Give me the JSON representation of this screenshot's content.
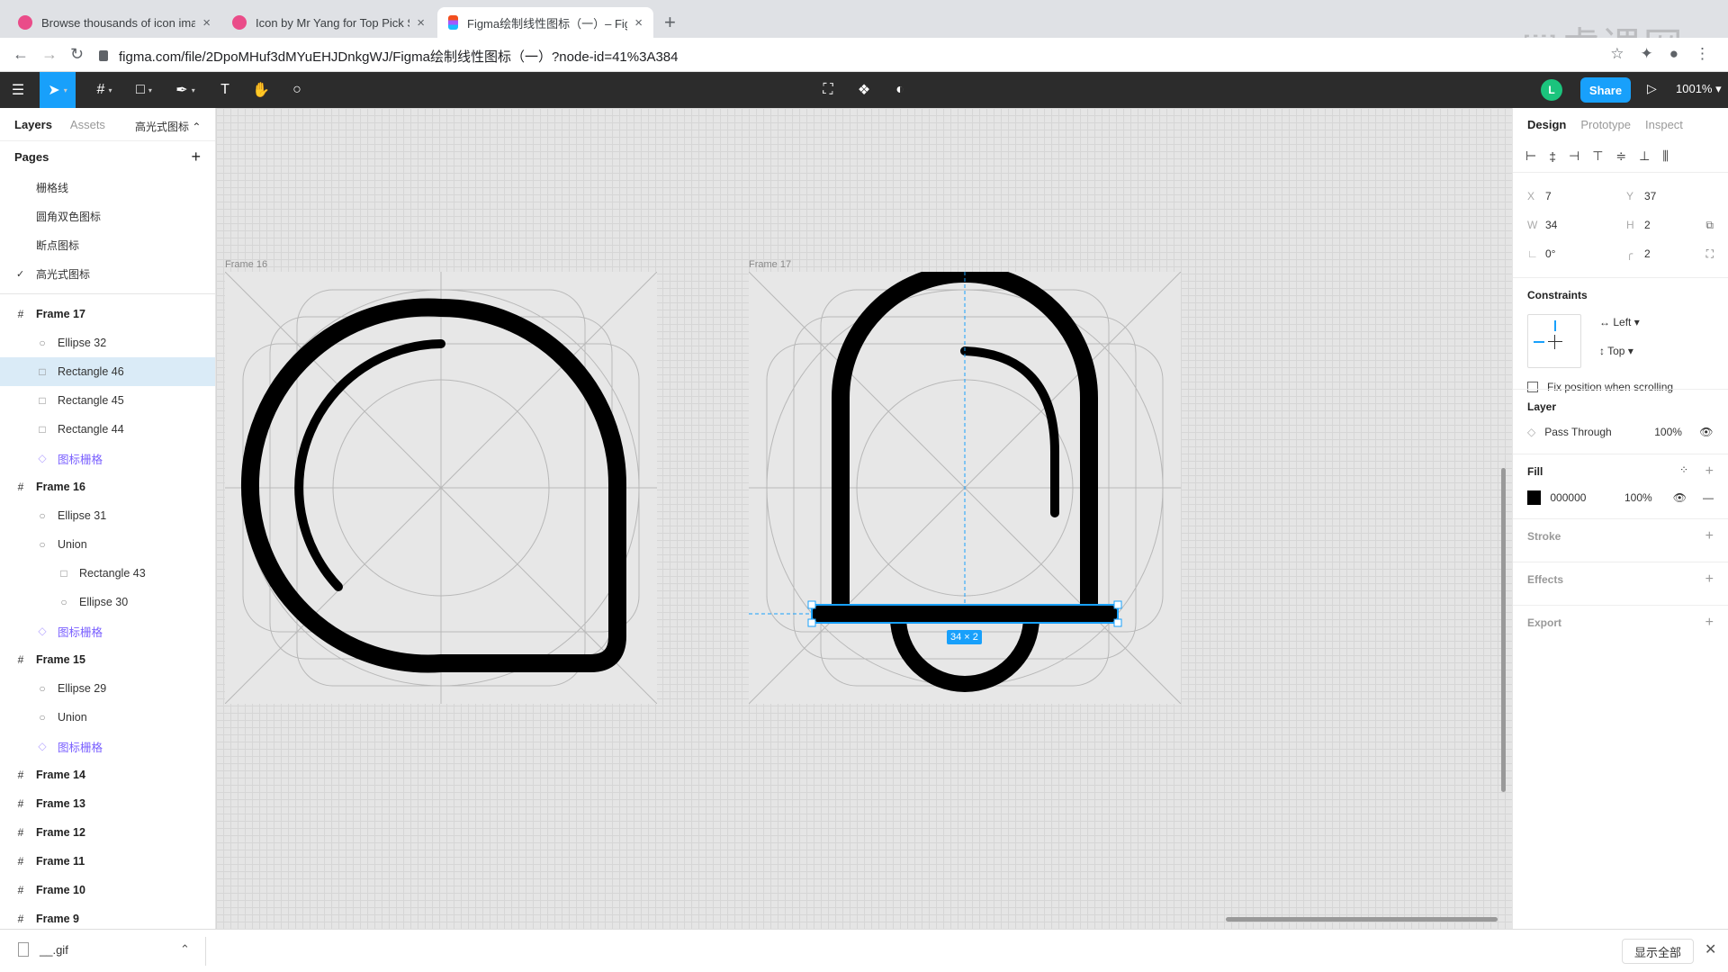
{
  "browser": {
    "tabs": [
      {
        "title": "Browse thousands of icon images",
        "favicon_color": "#ea4c89"
      },
      {
        "title": "Icon by Mr Yang for Top Pick Studio",
        "favicon_color": "#ea4c89"
      },
      {
        "title": "Figma绘制线性图标（一）– Figma",
        "favicon_color": "#f24e1e"
      }
    ],
    "url": "figma.com/file/2DpoMHuf3dMYuEHJDnkgWJ/Figma绘制线性图标（一）?node-id=41%3A384",
    "watermark": "虎课网"
  },
  "toolbar": {
    "avatar_initial": "L",
    "share_label": "Share",
    "zoom": "1001%"
  },
  "left_panel": {
    "tabs": [
      "Layers",
      "Assets"
    ],
    "current_page": "高光式图标 ⌃",
    "pages_title": "Pages",
    "pages": [
      {
        "name": "栅格线",
        "checked": false
      },
      {
        "name": "圆角双色图标",
        "checked": false
      },
      {
        "name": "断点图标",
        "checked": false
      },
      {
        "name": "高光式图标",
        "checked": true
      }
    ],
    "layers": [
      {
        "name": "Frame 17",
        "type": "frame",
        "indent": 16
      },
      {
        "name": "Ellipse 32",
        "type": "ellipse",
        "indent": 40
      },
      {
        "name": "Rectangle 46",
        "type": "rect",
        "indent": 40,
        "selected": true
      },
      {
        "name": "Rectangle 45",
        "type": "rect",
        "indent": 40
      },
      {
        "name": "Rectangle 44",
        "type": "rect",
        "indent": 40
      },
      {
        "name": "图标栅格",
        "type": "component",
        "indent": 40
      },
      {
        "name": "Frame 16",
        "type": "frame",
        "indent": 16
      },
      {
        "name": "Ellipse 31",
        "type": "ellipse",
        "indent": 40
      },
      {
        "name": "Union",
        "type": "ellipse",
        "indent": 40
      },
      {
        "name": "Rectangle 43",
        "type": "rect",
        "indent": 64
      },
      {
        "name": "Ellipse 30",
        "type": "ellipse",
        "indent": 64
      },
      {
        "name": "图标栅格",
        "type": "component",
        "indent": 40
      },
      {
        "name": "Frame 15",
        "type": "frame",
        "indent": 16
      },
      {
        "name": "Ellipse 29",
        "type": "ellipse",
        "indent": 40
      },
      {
        "name": "Union",
        "type": "ellipse",
        "indent": 40
      },
      {
        "name": "图标栅格",
        "type": "component",
        "indent": 40
      },
      {
        "name": "Frame 14",
        "type": "frame",
        "indent": 16
      },
      {
        "name": "Frame 13",
        "type": "frame",
        "indent": 16
      },
      {
        "name": "Frame 12",
        "type": "frame",
        "indent": 16
      },
      {
        "name": "Frame 11",
        "type": "frame",
        "indent": 16
      },
      {
        "name": "Frame 10",
        "type": "frame",
        "indent": 16
      },
      {
        "name": "Frame 9",
        "type": "frame",
        "indent": 16
      }
    ]
  },
  "canvas": {
    "frame_a_label": "Frame 16",
    "frame_b_label": "Frame 17",
    "size_badge": "34 × 2"
  },
  "right_panel": {
    "tabs": [
      "Design",
      "Prototype",
      "Inspect"
    ],
    "x_label": "X",
    "x": "7",
    "y_label": "Y",
    "y": "37",
    "w_label": "W",
    "w": "34",
    "h_label": "H",
    "h": "2",
    "rotation": "0°",
    "radius": "2",
    "constraints_title": "Constraints",
    "constraint_h": "Left",
    "constraint_v": "Top",
    "fix_position": "Fix position when scrolling",
    "layer_title": "Layer",
    "blend": "Pass Through",
    "layer_opacity": "100%",
    "fill_title": "Fill",
    "fill_hex": "000000",
    "fill_opacity": "100%",
    "fill_color": "#000000",
    "stroke_title": "Stroke",
    "effects_title": "Effects",
    "export_title": "Export"
  },
  "downloads": {
    "file": "__.gif",
    "show_all": "显示全部"
  }
}
